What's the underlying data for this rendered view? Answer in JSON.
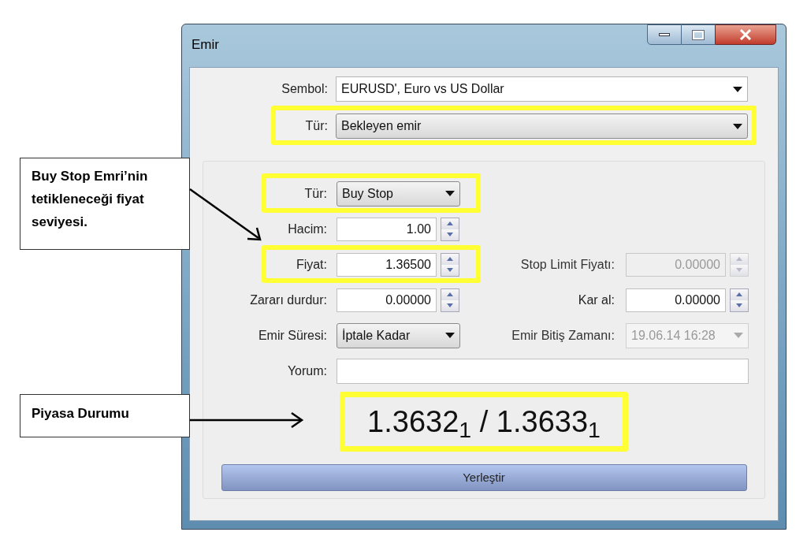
{
  "window": {
    "title": "Emir"
  },
  "symbol": {
    "label": "Sembol:",
    "value": "EURUSD', Euro vs US Dollar",
    "highlighted": false
  },
  "order_type": {
    "label": "Tür:",
    "value": "Bekleyen emir",
    "highlighted": true
  },
  "rows": [
    {
      "left": {
        "kind": "combo",
        "label": "Tür:",
        "value": "Buy Stop",
        "disabled": false,
        "highlighted": true
      }
    },
    {
      "left": {
        "kind": "spin",
        "label": "Hacim:",
        "value": "1.00",
        "disabled": false,
        "highlighted": false
      }
    },
    {
      "left": {
        "kind": "spin",
        "label": "Fiyat:",
        "value": "1.36500",
        "disabled": false,
        "highlighted": true
      },
      "right": {
        "kind": "spin",
        "label": "Stop Limit Fiyatı:",
        "value": "0.00000",
        "disabled": true,
        "highlighted": false
      }
    },
    {
      "left": {
        "kind": "spin",
        "label": "Zararı durdur:",
        "value": "0.00000",
        "disabled": false,
        "highlighted": false
      },
      "right": {
        "kind": "spin",
        "label": "Kar al:",
        "value": "0.00000",
        "disabled": false,
        "highlighted": false
      }
    },
    {
      "left": {
        "kind": "combo",
        "label": "Emir Süresi:",
        "value": "İptale Kadar",
        "disabled": false,
        "highlighted": false
      },
      "right": {
        "kind": "combo",
        "label": "Emir Bitiş Zamanı:",
        "value": "19.06.14 16:28",
        "disabled": true,
        "highlighted": false
      }
    },
    {
      "left": {
        "kind": "text",
        "label": "Yorum:",
        "disabled": false,
        "highlighted": false
      }
    }
  ],
  "quote": {
    "text": "1.3632$_{1}$ / 1.3633$_{1}$",
    "highlighted": true
  },
  "button": "Yerleştir",
  "callouts": [
    {
      "text": "Buy Stop Emri’nin tetikleneceği fiyat seviyesi."
    },
    {
      "text": "Piyasa Durumu"
    }
  ]
}
